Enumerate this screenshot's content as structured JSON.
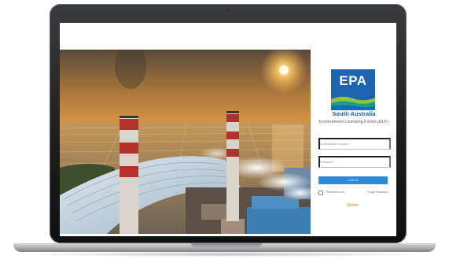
{
  "brand": {
    "logo_text": "EPA",
    "sub_text": "South Australia",
    "logo_color": "#1c64b0"
  },
  "app": {
    "title": "Environment Licensing Forms (ELF)"
  },
  "form": {
    "authorisation_placeholder": "Authorisation Number*",
    "password_placeholder": "Password*",
    "login_label": "LOG IN",
    "remember_label": "Remember me",
    "forgot_label": "Forgot Password",
    "home_label": "Home",
    "button_color": "#2c8ad6",
    "link_color": "#e07a2e"
  },
  "hero": {
    "subject": "industrial power plant with smokestacks at sunset",
    "icon": "photo"
  }
}
